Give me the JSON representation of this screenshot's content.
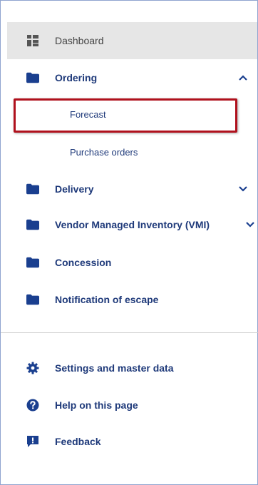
{
  "nav": {
    "dashboard": {
      "label": "Dashboard",
      "icon": "dashboard-grid-icon"
    },
    "ordering": {
      "label": "Ordering",
      "icon": "folder-icon",
      "expanded": true,
      "children": [
        {
          "label": "Forecast",
          "highlighted": true
        },
        {
          "label": "Purchase orders"
        }
      ]
    },
    "delivery": {
      "label": "Delivery",
      "icon": "folder-icon",
      "expanded": false
    },
    "vmi": {
      "label": "Vendor Managed Inventory (VMI)",
      "icon": "folder-icon",
      "expanded": false
    },
    "concession": {
      "label": "Concession",
      "icon": "folder-icon"
    },
    "notification": {
      "label": "Notification of escape",
      "icon": "folder-icon"
    }
  },
  "footer": {
    "settings": {
      "label": "Settings and master data",
      "icon": "gear-icon"
    },
    "help": {
      "label": "Help on this page",
      "icon": "question-circle-icon"
    },
    "feedback": {
      "label": "Feedback",
      "icon": "feedback-icon"
    }
  },
  "colors": {
    "link": "#1f3a7a",
    "icon": "#1a3f8f",
    "highlight_border": "#b0111d",
    "dashboard_bg": "#e6e6e6"
  }
}
